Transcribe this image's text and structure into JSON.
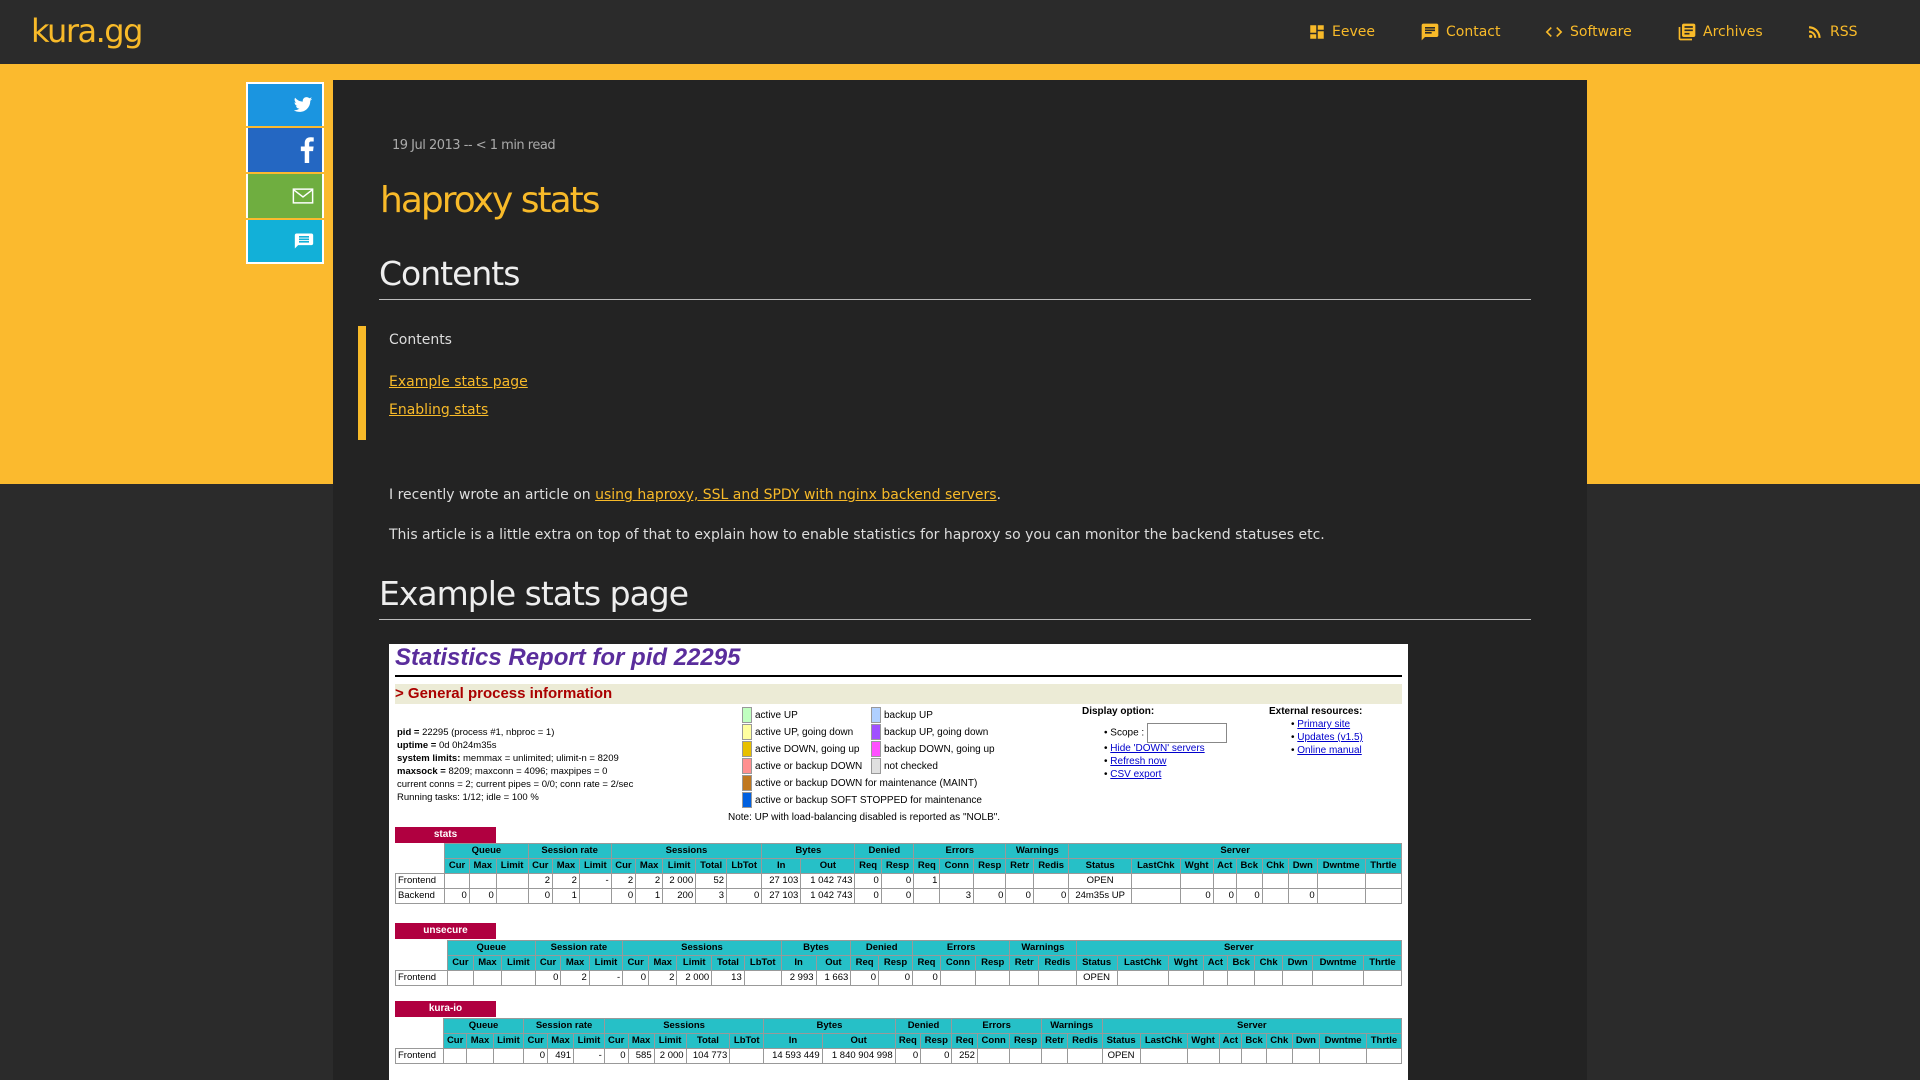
{
  "site": {
    "logo": "kura.gg"
  },
  "nav": [
    {
      "label": "Eevee",
      "icon": "dashboard-icon"
    },
    {
      "label": "Contact",
      "icon": "chat-icon"
    },
    {
      "label": "Software",
      "icon": "code-icon"
    },
    {
      "label": "Archives",
      "icon": "library-icon"
    },
    {
      "label": "RSS",
      "icon": "rss-icon"
    }
  ],
  "share": [
    {
      "name": "twitter",
      "color": "#1b95e0"
    },
    {
      "name": "facebook",
      "color": "#2467c2"
    },
    {
      "name": "email",
      "color": "#6fae40"
    },
    {
      "name": "comments",
      "color": "#12b0d8"
    }
  ],
  "article": {
    "meta": "19 Jul 2013 -- < 1 min read",
    "title": "haproxy stats",
    "contents_heading": "Contents",
    "toc_label": "Contents",
    "toc": [
      "Example stats page",
      "Enabling stats"
    ],
    "p1_before": "I recently wrote an article on ",
    "p1_link": "using haproxy, SSL and SPDY with nginx backend servers",
    "p1_after": ".",
    "p2": "This article is a little extra on top of that to explain how to enable statistics for haproxy so you can monitor the backend statuses etc.",
    "example_heading": "Example stats page"
  },
  "stats": {
    "title": "Statistics Report for pid 22295",
    "general": "> General process information",
    "info": [
      {
        "k": "pid = ",
        "v": "22295 (process #1, nbproc = 1)"
      },
      {
        "k": "uptime = ",
        "v": "0d 0h24m35s"
      },
      {
        "k": "system limits: ",
        "v": "memmax = unlimited; ulimit-n = 8209"
      },
      {
        "k": "maxsock = ",
        "v": "8209; maxconn = 4096; maxpipes = 0"
      },
      {
        "k": "",
        "v": "current conns = 2; current pipes = 0/0; conn rate = 2/sec"
      },
      {
        "k": "",
        "v": "Running tasks: 1/12; idle = 100 %"
      }
    ],
    "legend_left": [
      "active UP",
      "active UP, going down",
      "active DOWN, going up",
      "active or backup DOWN",
      "active or backup DOWN for maintenance (MAINT)",
      "active or backup SOFT STOPPED for maintenance"
    ],
    "legend_left_colors": [
      "#c0ffc0",
      "#ffffa0",
      "#e8c000",
      "#ff9090",
      "#c07820",
      "#0060e0"
    ],
    "legend_right": [
      "backup UP",
      "backup UP, going down",
      "backup DOWN, going up",
      "not checked"
    ],
    "legend_right_colors": [
      "#b0d0ff",
      "#a050ff",
      "#ff50ff",
      "#e0e0e0"
    ],
    "note": "Note: UP with load-balancing disabled is reported as \"NOLB\".",
    "display_option": "Display option:",
    "scope": "Scope :",
    "options": [
      "Hide 'DOWN' servers",
      "Refresh now",
      "CSV export"
    ],
    "external": "External resources:",
    "resources": [
      "Primary site",
      "Updates (v1.5)",
      "Online manual"
    ],
    "groups": [
      "Queue",
      "Session rate",
      "Sessions",
      "Bytes",
      "Denied",
      "Errors",
      "Warnings",
      "Server"
    ],
    "cols": [
      "Cur",
      "Max",
      "Limit",
      "Cur",
      "Max",
      "Limit",
      "Cur",
      "Max",
      "Limit",
      "Total",
      "LbTot",
      "In",
      "Out",
      "Req",
      "Resp",
      "Req",
      "Conn",
      "Resp",
      "Retr",
      "Redis",
      "Status",
      "LastChk",
      "Wght",
      "Act",
      "Bck",
      "Chk",
      "Dwn",
      "Dwntme",
      "Thrtle"
    ],
    "proxies": [
      {
        "name": "stats",
        "rows": [
          [
            "Frontend",
            "",
            "",
            "",
            "2",
            "2",
            "-",
            "2",
            "2",
            "2 000",
            "52",
            "",
            "27 103",
            "1 042 743",
            "0",
            "0",
            "1",
            "",
            "",
            "",
            "",
            "OPEN",
            "",
            "",
            "",
            "",
            "",
            "",
            "",
            ""
          ],
          [
            "Backend",
            "0",
            "0",
            "",
            "0",
            "1",
            "",
            "0",
            "1",
            "200",
            "3",
            "0",
            "27 103",
            "1 042 743",
            "0",
            "0",
            "",
            "3",
            "0",
            "0",
            "0",
            "24m35s UP",
            "",
            "0",
            "0",
            "0",
            "",
            "0",
            "",
            ""
          ]
        ]
      },
      {
        "name": "unsecure",
        "rows": [
          [
            "Frontend",
            "",
            "",
            "",
            "0",
            "2",
            "-",
            "0",
            "2",
            "2 000",
            "13",
            "",
            "2 993",
            "1 663",
            "0",
            "0",
            "0",
            "",
            "",
            "",
            "",
            "OPEN",
            "",
            "",
            "",
            "",
            "",
            "",
            "",
            ""
          ]
        ]
      },
      {
        "name": "kura-io",
        "rows": [
          [
            "Frontend",
            "",
            "",
            "",
            "0",
            "491",
            "-",
            "0",
            "585",
            "2 000",
            "104 773",
            "",
            "14 593 449",
            "1 840 904 998",
            "0",
            "0",
            "252",
            "",
            "",
            "",
            "",
            "OPEN",
            "",
            "",
            "",
            "",
            "",
            "",
            "",
            ""
          ]
        ]
      }
    ]
  }
}
